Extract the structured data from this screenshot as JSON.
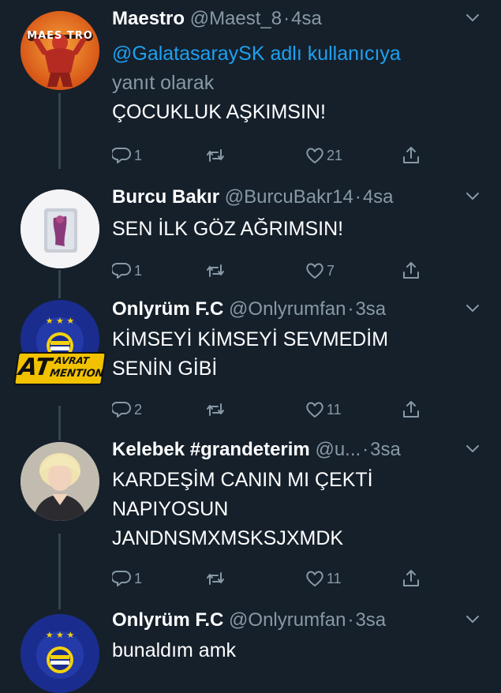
{
  "colors": {
    "background": "#15202b",
    "text_primary": "#ffffff",
    "text_secondary": "#8899a6",
    "link": "#1da1f2",
    "thread_line": "#38444d"
  },
  "tweets": [
    {
      "name": "Maestro",
      "handle": "@Maest_8",
      "separator": "·",
      "time": "4sa",
      "mention": "@GalatasaraySK adlı kullanıcıya",
      "reply_label": "yanıt olarak",
      "lines": [
        "ÇOCUKLUK AŞKIMSIN!"
      ],
      "avatar_text": "MAES TRO",
      "avatar_icon": "maestro-logo",
      "replies": "1",
      "retweets": "",
      "likes": "21"
    },
    {
      "name": "Burcu Bakır",
      "handle": "@BurcuBakr14",
      "separator": "·",
      "time": "4sa",
      "lines": [
        "SEN İLK GÖZ AĞRIMSIN!"
      ],
      "avatar_icon": "profile-photo",
      "replies": "1",
      "retweets": "",
      "likes": "7"
    },
    {
      "name": "Onlyrüm F.C",
      "handle": "@Onlyrumfan",
      "separator": "·",
      "time": "3sa",
      "lines": [
        "KİMSEYİ KİMSEYİ SEVMEDİM",
        "SENİN GİBİ"
      ],
      "avatar_icon": "fenerbahce-logo",
      "watermark": {
        "big": "AT",
        "top": "AVRAT",
        "bottom": "MENTION"
      },
      "replies": "2",
      "retweets": "",
      "likes": "11"
    },
    {
      "name": "Kelebek #grandeterim",
      "handle": "@u...",
      "separator": "·",
      "time": "3sa",
      "lines": [
        "KARDEŞİM CANIN MI ÇEKTİ",
        "NAPIYOSUN",
        "JANDNSMXMSKSJXMDK"
      ],
      "avatar_icon": "profile-photo",
      "replies": "1",
      "retweets": "",
      "likes": "11"
    },
    {
      "name": "Onlyrüm F.C",
      "handle": "@Onlyrumfan",
      "separator": "·",
      "time": "3sa",
      "lines": [
        "bunaldım amk"
      ],
      "avatar_icon": "fenerbahce-logo"
    }
  ]
}
